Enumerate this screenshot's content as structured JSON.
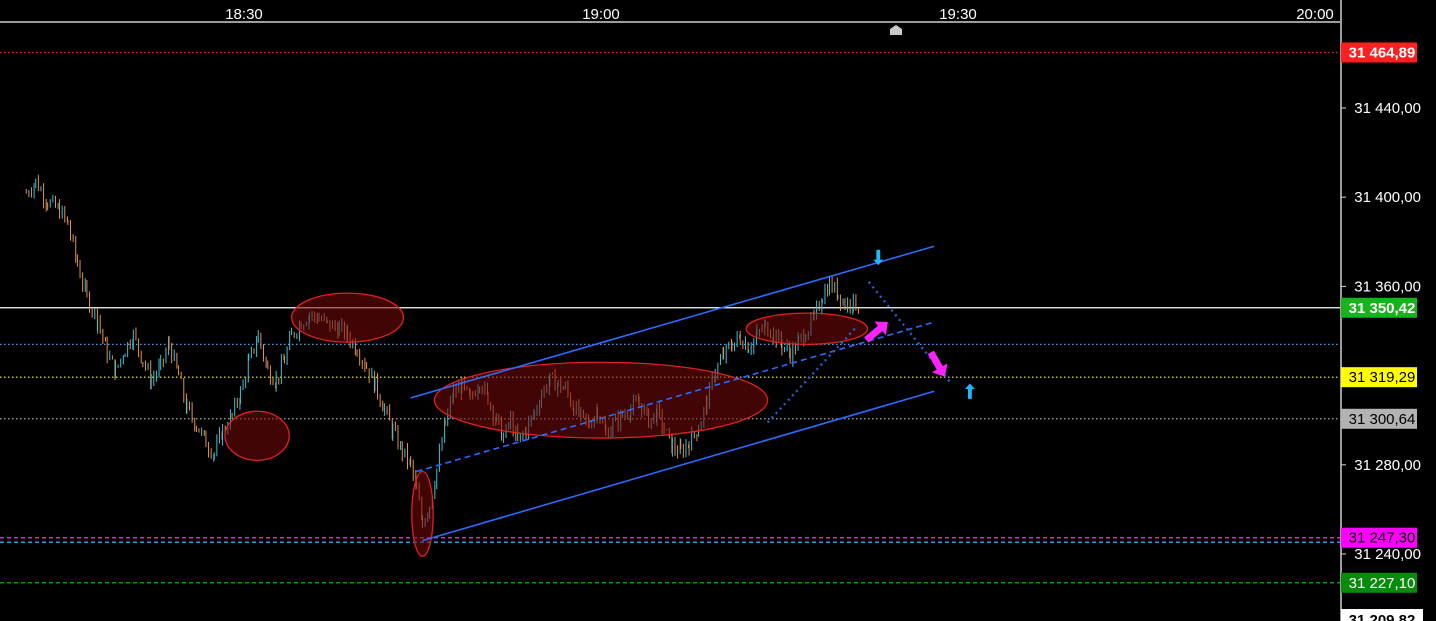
{
  "chart_data": {
    "type": "candlestick",
    "x_axis": {
      "ticks": [
        {
          "label": "18:30",
          "minute": 0
        },
        {
          "label": "19:00",
          "minute": 30
        },
        {
          "label": "19:30",
          "minute": 60
        },
        {
          "label": "20:00",
          "minute": 90
        }
      ]
    },
    "y_axis": {
      "ylim": [
        31209.82,
        31475.0
      ],
      "ticks": [
        {
          "label": "31 440,00",
          "value": 31440.0
        },
        {
          "label": "31 400,00",
          "value": 31400.0
        },
        {
          "label": "31 360,00",
          "value": 31360.0
        },
        {
          "label": "31 280,00",
          "value": 31280.0
        },
        {
          "label": "31 240,00",
          "value": 31240.0
        }
      ]
    },
    "price_lines": [
      {
        "label": "31 464,89",
        "value": 31464.89,
        "line_color": "#e2302c",
        "badge_bg": "#ff1f1f",
        "badge_text_color": "#ffffff",
        "style": "dotted"
      },
      {
        "label": "31 350,42",
        "value": 31350.42,
        "line_color": "#ffffff",
        "badge_bg": "#16b31a",
        "badge_text_color": "#ffffff",
        "style": "solid"
      },
      {
        "label": "",
        "value": 31334.0,
        "line_color": "#3fa8ff",
        "style": "dotted"
      },
      {
        "label": "31 319,29",
        "value": 31319.29,
        "line_color": "#ffff3a",
        "badge_bg": "#ffff00",
        "badge_text_color": "#000000",
        "style": "dotted"
      },
      {
        "label": "31 300,64",
        "value": 31300.64,
        "line_color": "#aaaaaa",
        "badge_bg": "#b3b3b3",
        "badge_text_color": "#000000",
        "style": "dotted"
      },
      {
        "label": "31 247,30",
        "value": 31247.3,
        "line_color": "#ff2bff",
        "badge_bg": "#ff00ff",
        "badge_text_color": "#000000",
        "style": "dashed"
      },
      {
        "label": "",
        "value": 31245.3,
        "line_color": "#38d9ff",
        "style": "dashed"
      },
      {
        "label": "31 227,10",
        "value": 31227.1,
        "line_color": "#18b318",
        "badge_bg": "#0a8a0a",
        "badge_text_color": "#ffffff",
        "style": "dashed"
      }
    ],
    "cut_off_label": "31 209,82",
    "close_path": [
      [
        -18.3,
        31402
      ],
      [
        -17.5,
        31407
      ],
      [
        -16.5,
        31398
      ],
      [
        -15.5,
        31394
      ],
      [
        -14.8,
        31388
      ],
      [
        -14.0,
        31370
      ],
      [
        -13.2,
        31355
      ],
      [
        -12.3,
        31345
      ],
      [
        -11.5,
        31330
      ],
      [
        -10.8,
        31322
      ],
      [
        -10.0,
        31332
      ],
      [
        -9.3,
        31338
      ],
      [
        -8.5,
        31327
      ],
      [
        -7.8,
        31318
      ],
      [
        -7.0,
        31324
      ],
      [
        -6.3,
        31334
      ],
      [
        -5.5,
        31320
      ],
      [
        -4.8,
        31305
      ],
      [
        -4.0,
        31298
      ],
      [
        -3.2,
        31290
      ],
      [
        -2.5,
        31285
      ],
      [
        -1.8,
        31295
      ],
      [
        -1.0,
        31302
      ],
      [
        -0.3,
        31312
      ],
      [
        0.4,
        31326
      ],
      [
        1.2,
        31338
      ],
      [
        2.0,
        31322
      ],
      [
        2.7,
        31318
      ],
      [
        3.4,
        31327
      ],
      [
        4.0,
        31338
      ],
      [
        4.8,
        31344
      ],
      [
        5.5,
        31347
      ],
      [
        6.3,
        31346
      ],
      [
        7.0,
        31343
      ],
      [
        8.0,
        31341
      ],
      [
        8.7,
        31338
      ],
      [
        9.5,
        31332
      ],
      [
        10.3,
        31324
      ],
      [
        11.0,
        31316
      ],
      [
        11.8,
        31305
      ],
      [
        12.5,
        31295
      ],
      [
        13.3,
        31286
      ],
      [
        14.0,
        31280
      ],
      [
        14.5,
        31268
      ],
      [
        15.0,
        31255
      ],
      [
        15.6,
        31262
      ],
      [
        16.2,
        31278
      ],
      [
        16.9,
        31298
      ],
      [
        17.6,
        31312
      ],
      [
        18.3,
        31315
      ],
      [
        19.0,
        31309
      ],
      [
        19.8,
        31318
      ],
      [
        20.5,
        31310
      ],
      [
        21.2,
        31300
      ],
      [
        21.8,
        31292
      ],
      [
        22.4,
        31300
      ],
      [
        23.0,
        31290
      ],
      [
        23.7,
        31296
      ],
      [
        24.4,
        31303
      ],
      [
        25.0,
        31312
      ],
      [
        25.7,
        31318
      ],
      [
        26.4,
        31316
      ],
      [
        27.0,
        31314
      ],
      [
        27.7,
        31306
      ],
      [
        28.3,
        31301
      ],
      [
        29.0,
        31298
      ],
      [
        29.7,
        31305
      ],
      [
        30.4,
        31294
      ],
      [
        31.0,
        31298
      ],
      [
        31.8,
        31302
      ],
      [
        32.5,
        31305
      ],
      [
        33.2,
        31308
      ],
      [
        34.0,
        31300
      ],
      [
        34.7,
        31303
      ],
      [
        35.3,
        31296
      ],
      [
        36.0,
        31288
      ],
      [
        36.7,
        31286
      ],
      [
        37.4,
        31290
      ],
      [
        38.2,
        31297
      ],
      [
        38.9,
        31308
      ],
      [
        39.6,
        31322
      ],
      [
        40.3,
        31329
      ],
      [
        41.0,
        31334
      ],
      [
        41.7,
        31337
      ],
      [
        42.4,
        31333
      ],
      [
        43.1,
        31338
      ],
      [
        43.8,
        31342
      ],
      [
        44.5,
        31339
      ],
      [
        45.2,
        31334
      ],
      [
        45.9,
        31330
      ],
      [
        46.6,
        31335
      ],
      [
        47.2,
        31340
      ],
      [
        47.9,
        31345
      ],
      [
        48.6,
        31356
      ],
      [
        49.2,
        31361
      ],
      [
        49.9,
        31357
      ],
      [
        50.5,
        31352
      ],
      [
        51.2,
        31353
      ],
      [
        51.8,
        31350
      ]
    ],
    "shapes": {
      "ellipses": [
        {
          "cx": 1.1,
          "cy": 31293,
          "rx": 2.7,
          "ry": 11,
          "color": "#e02020"
        },
        {
          "cx": 8.7,
          "cy": 31346,
          "rx": 4.7,
          "ry": 11,
          "color": "#e02020"
        },
        {
          "cx": 15.0,
          "cy": 31258,
          "rx": 0.9,
          "ry": 19,
          "color": "#e02020"
        },
        {
          "cx": 30.0,
          "cy": 31309,
          "rx": 14.0,
          "ry": 17,
          "color": "#e02020"
        },
        {
          "cx": 47.3,
          "cy": 31341,
          "rx": 5.1,
          "ry": 7,
          "color": "#e02020"
        }
      ],
      "trendlines": [
        {
          "x1": 14.0,
          "y1": 31310,
          "x2": 58.0,
          "y2": 31378,
          "color": "#2a6bff",
          "style": "solid"
        },
        {
          "x1": 15.0,
          "y1": 31246,
          "x2": 58.0,
          "y2": 31313,
          "color": "#2a6bff",
          "style": "solid"
        },
        {
          "x1": 14.5,
          "y1": 31277,
          "x2": 58.0,
          "y2": 31344,
          "color": "#2a6bff",
          "style": "dashed"
        },
        {
          "x1": 44.0,
          "y1": 31299,
          "x2": 51.5,
          "y2": 31342,
          "color": "#2a5bd8",
          "style": "dotted"
        },
        {
          "x1": 52.5,
          "y1": 31362,
          "x2": 59.5,
          "y2": 31316,
          "color": "#2a5bd8",
          "style": "dotted"
        }
      ],
      "arrows": [
        {
          "name": "up-arrow-icon",
          "x": 53.2,
          "y": 31340,
          "dir": "up-right",
          "color": "#ff22ff",
          "size": "big"
        },
        {
          "name": "down-arrow-icon",
          "x": 58.3,
          "y": 31325,
          "dir": "down-right",
          "color": "#ff22ff",
          "size": "big"
        },
        {
          "name": "down-arrow-icon",
          "x": 53.3,
          "y": 31373,
          "dir": "down",
          "color": "#1fb8ff",
          "size": "small"
        },
        {
          "name": "up-arrow-icon",
          "x": 61.0,
          "y": 31313,
          "dir": "up",
          "color": "#1fb8ff",
          "size": "small"
        }
      ]
    }
  }
}
